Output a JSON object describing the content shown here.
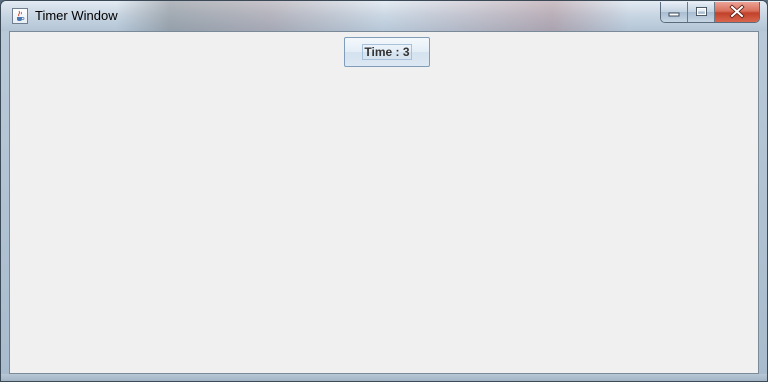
{
  "window": {
    "title": "Timer Window",
    "app_icon": "java-cup-icon",
    "controls": {
      "minimize_icon": "minimize-icon",
      "maximize_icon": "maximize-icon",
      "close_icon": "close-icon"
    }
  },
  "content": {
    "timer_label": "Time : 3"
  },
  "colors": {
    "client_background": "#f0f0f0",
    "button_border": "#7f9db9",
    "close_red": "#c2412a"
  }
}
